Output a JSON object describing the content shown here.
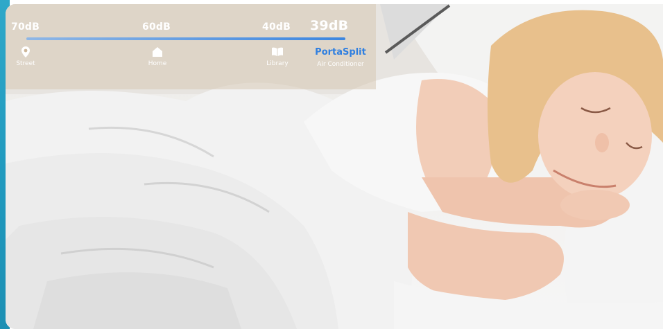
{
  "noise_scale": {
    "levels": [
      {
        "value": "70dB",
        "place": "Street",
        "icon": "map-pin-icon"
      },
      {
        "value": "60dB",
        "place": "Home",
        "icon": "house-icon"
      },
      {
        "value": "40dB",
        "place": "Library",
        "icon": "book-icon"
      }
    ],
    "product": {
      "value": "39dB",
      "name": "PortaSplit",
      "category": "Air Conditioner"
    }
  },
  "colors": {
    "accent": "#2fa8c9",
    "brand": "#2f7fe0",
    "bar_start": "#8fb7e6",
    "bar_end": "#3c86e0"
  }
}
